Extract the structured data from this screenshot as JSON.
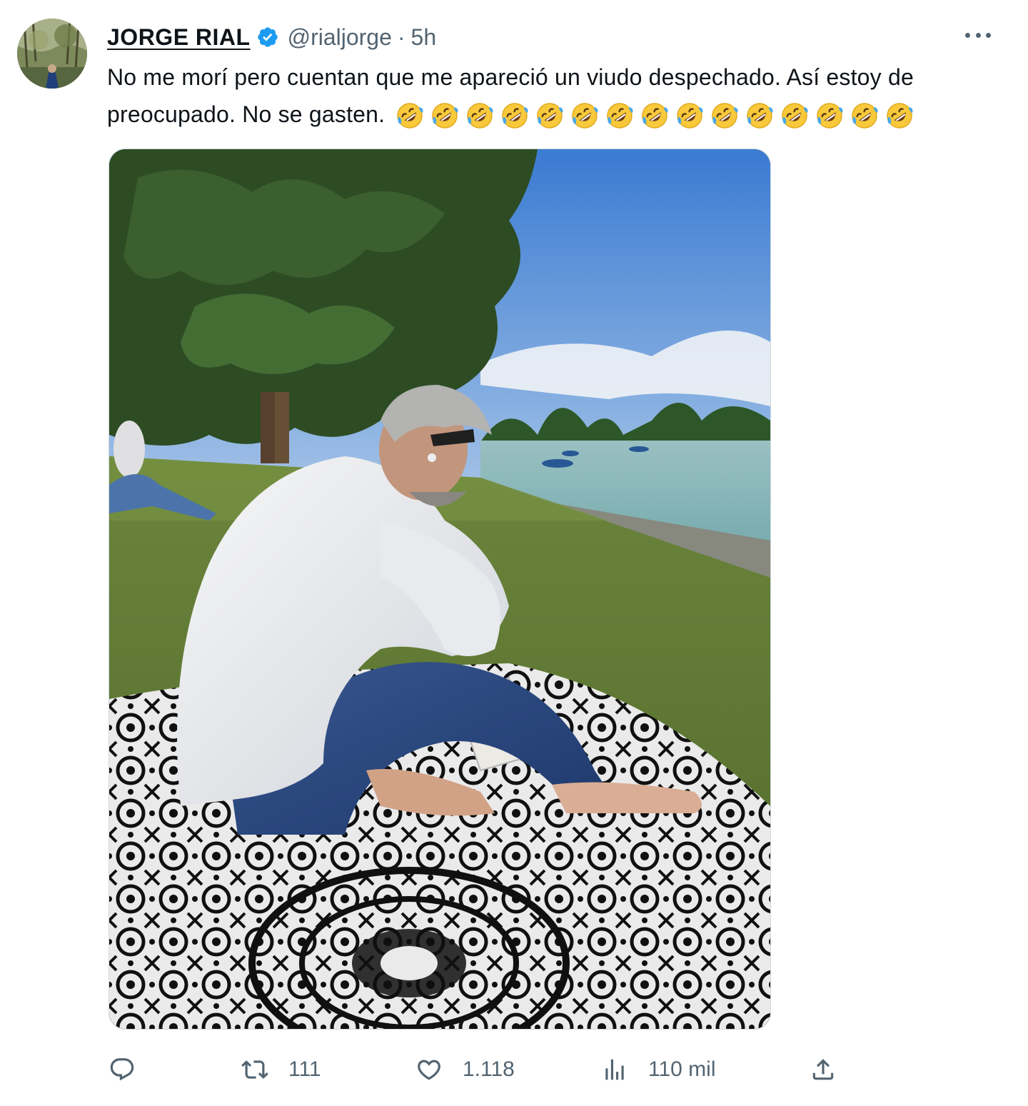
{
  "tweet": {
    "author": {
      "display_name": "JORGE RIAL",
      "handle": "@rialjorge",
      "verified": true
    },
    "separator": "·",
    "time": "5h",
    "text": "No me morí pero cuentan que me apareció un viudo despechado. Así estoy de preocupado. No se gasten.",
    "emoji": {
      "name": "rolling-on-the-floor-laughing",
      "count": 15
    },
    "media": {
      "type": "photo"
    },
    "actions": {
      "reply": {
        "icon": "reply-icon",
        "count": ""
      },
      "retweet": {
        "icon": "retweet-icon",
        "count": "111"
      },
      "like": {
        "icon": "heart-icon",
        "count": "1.118"
      },
      "views": {
        "icon": "views-icon",
        "count": "110 mil"
      },
      "share": {
        "icon": "share-icon"
      }
    }
  },
  "colors": {
    "text": "#0f1419",
    "secondary": "#536471",
    "verified": "#1d9bf0",
    "border": "#cfd9de"
  }
}
